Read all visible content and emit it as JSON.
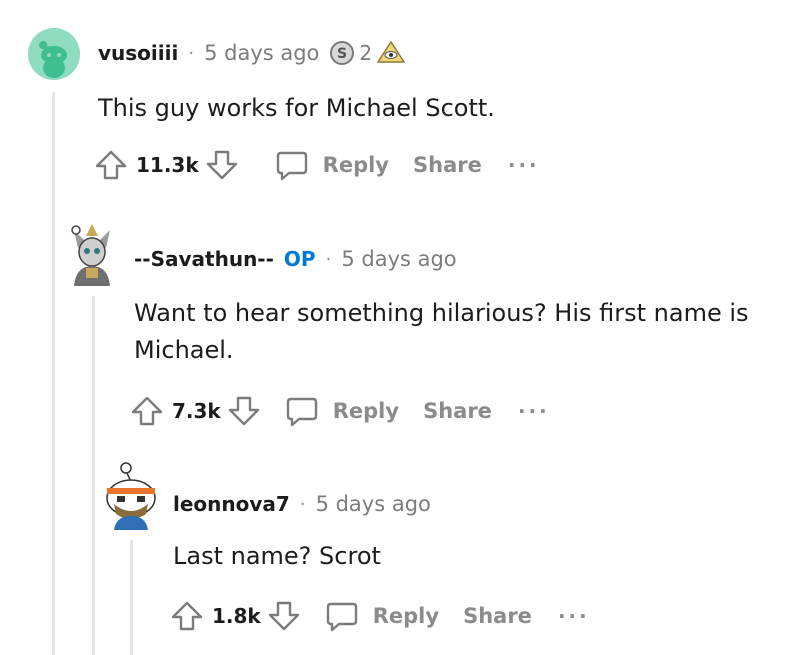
{
  "comments": [
    {
      "username": "vusoiiii",
      "separator": "·",
      "timestamp": "5 days ago",
      "award_count": "2",
      "text": "This guy works for Michael Scott.",
      "score": "11.3k",
      "reply_label": "Reply",
      "share_label": "Share",
      "more_label": "···"
    },
    {
      "username": "--Savathun--",
      "op_badge": "OP",
      "separator": "·",
      "timestamp": "5 days ago",
      "text": "Want to hear something hilarious? His first name is Michael.",
      "score": "7.3k",
      "reply_label": "Reply",
      "share_label": "Share",
      "more_label": "···"
    },
    {
      "username": "leonnova7",
      "separator": "·",
      "timestamp": "5 days ago",
      "text": "Last name? Scrot",
      "score": "1.8k",
      "reply_label": "Reply",
      "share_label": "Share",
      "more_label": "···"
    }
  ],
  "colors": {
    "avatar_mint": "#8fdcc0",
    "op_blue": "#0079d3",
    "meta_gray": "#7c7c7c",
    "thread_line": "#e6e6e6"
  },
  "icons": [
    "upvote-icon",
    "downvote-icon",
    "comment-bubble-icon",
    "silver-award-icon",
    "helpful-award-icon"
  ]
}
